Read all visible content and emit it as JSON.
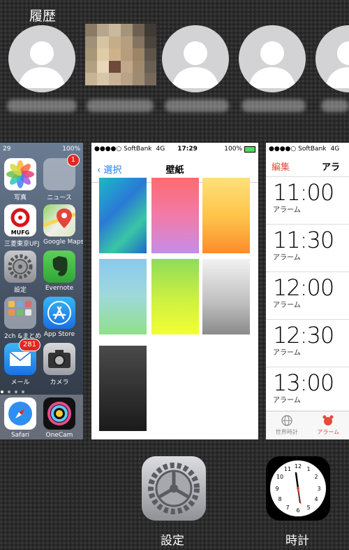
{
  "history": {
    "title": "履歴"
  },
  "home_card": {
    "status_time": "29",
    "status_battery": "100%",
    "apps": [
      {
        "label": "写真"
      },
      {
        "label": "ニュース",
        "badge": "1"
      },
      {
        "label": "三菱東京UFJ",
        "icon_text": "MUFG"
      },
      {
        "label": "Google Maps"
      },
      {
        "label": "設定"
      },
      {
        "label": "Evernote"
      },
      {
        "label": "2ch &まとめ"
      },
      {
        "label": "App Store"
      },
      {
        "label": "メール",
        "badge": "281"
      },
      {
        "label": "カメラ"
      }
    ],
    "dock": [
      {
        "label": "Safari"
      },
      {
        "label": "OneCam"
      }
    ]
  },
  "wallpaper_card": {
    "carrier": "●●●●○ SoftBank",
    "network": "4G",
    "time": "17:29",
    "battery": "100%",
    "back_label": "選択",
    "title": "壁紙"
  },
  "clock_card": {
    "carrier": "●●●●○ SoftBank",
    "network": "4G",
    "edit_label": "編集",
    "title": "アラ",
    "alarms": [
      {
        "time": "11:00",
        "label": "アラーム"
      },
      {
        "time": "11:30",
        "label": "アラーム"
      },
      {
        "time": "12:00",
        "label": "アラーム"
      },
      {
        "time": "12:30",
        "label": "アラーム"
      },
      {
        "time": "13:00",
        "label": "アラーム"
      }
    ],
    "tabs": [
      {
        "label": "世界時計"
      },
      {
        "label": "アラーム"
      }
    ]
  },
  "switcher": {
    "settings_label": "設定",
    "clock_label": "時計"
  },
  "colors": {
    "ios_blue": "#1a7cf5",
    "clock_red": "#e54a3c",
    "badge_red": "#e0281f"
  }
}
